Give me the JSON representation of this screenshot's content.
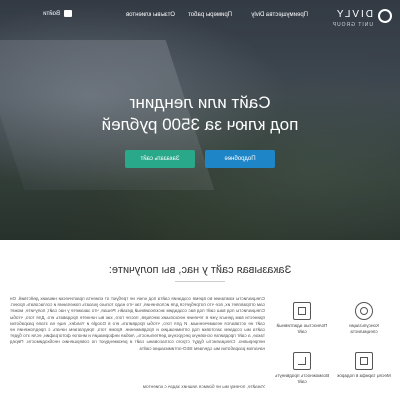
{
  "nav": {
    "logo_text": "DIVLY",
    "logo_sub": "UNIT GROUP",
    "links": [
      "Преимущества Divly",
      "Примеры работ",
      "Отзывы клиентов"
    ],
    "login_label": "Войти"
  },
  "hero": {
    "title_line1": "Сайт или лендинг",
    "title_line2": "под ключ за 3500 рублей",
    "order_button": "Заказать сайт",
    "more_button": "Подробнее"
  },
  "section": {
    "title": "Заказывая сайт у нас, вы получите:",
    "paragraph": "Специалисты компании во время создания сайта под ключ не требуют от клиента практически никаких действий. Он сам отправляет их, все что потребуется для исполнения, так что надо только указать пожелания и согласовать проект. Специалисты под ваш сайт под вас создадим эксклюзивный дизайн. Решая, что закажете у нас сайт, получите, может принести вам деньги уже в течение нескольких месяцев, после того, как вы начнете продавать его. Для того, чтобы сайт не оставался незамеченным. И для того, чтобы продвигать его в Google и Yandex, еще на этапе разработки сайта мы создаем заготовки под оптимизацию и продвижение. Кроме того, предлагаем начать с предложения не такое, а сайт продвигая основную ресурсную деятельность, любая информация и многое фотографии, если это будет непрерывно. Специалисты будут строго согласованы сайт и рекомендуют по совершению необходимости. Перед началом разработки мы сделаем SEO-оптимизацию сайта",
    "footer_line": "Узнайте, почему мы не боимся лишних задач с клиентом",
    "features": [
      {
        "icon": "headset-icon",
        "label": "Консультации специалиста"
      },
      {
        "icon": "browser-icon",
        "label": "Полностью адаптивный сайт"
      },
      {
        "icon": "gift-icon",
        "label": "Месяц тарифа в подарок"
      },
      {
        "icon": "chart-icon",
        "label": "Возможность продвинуть сайт"
      }
    ]
  }
}
